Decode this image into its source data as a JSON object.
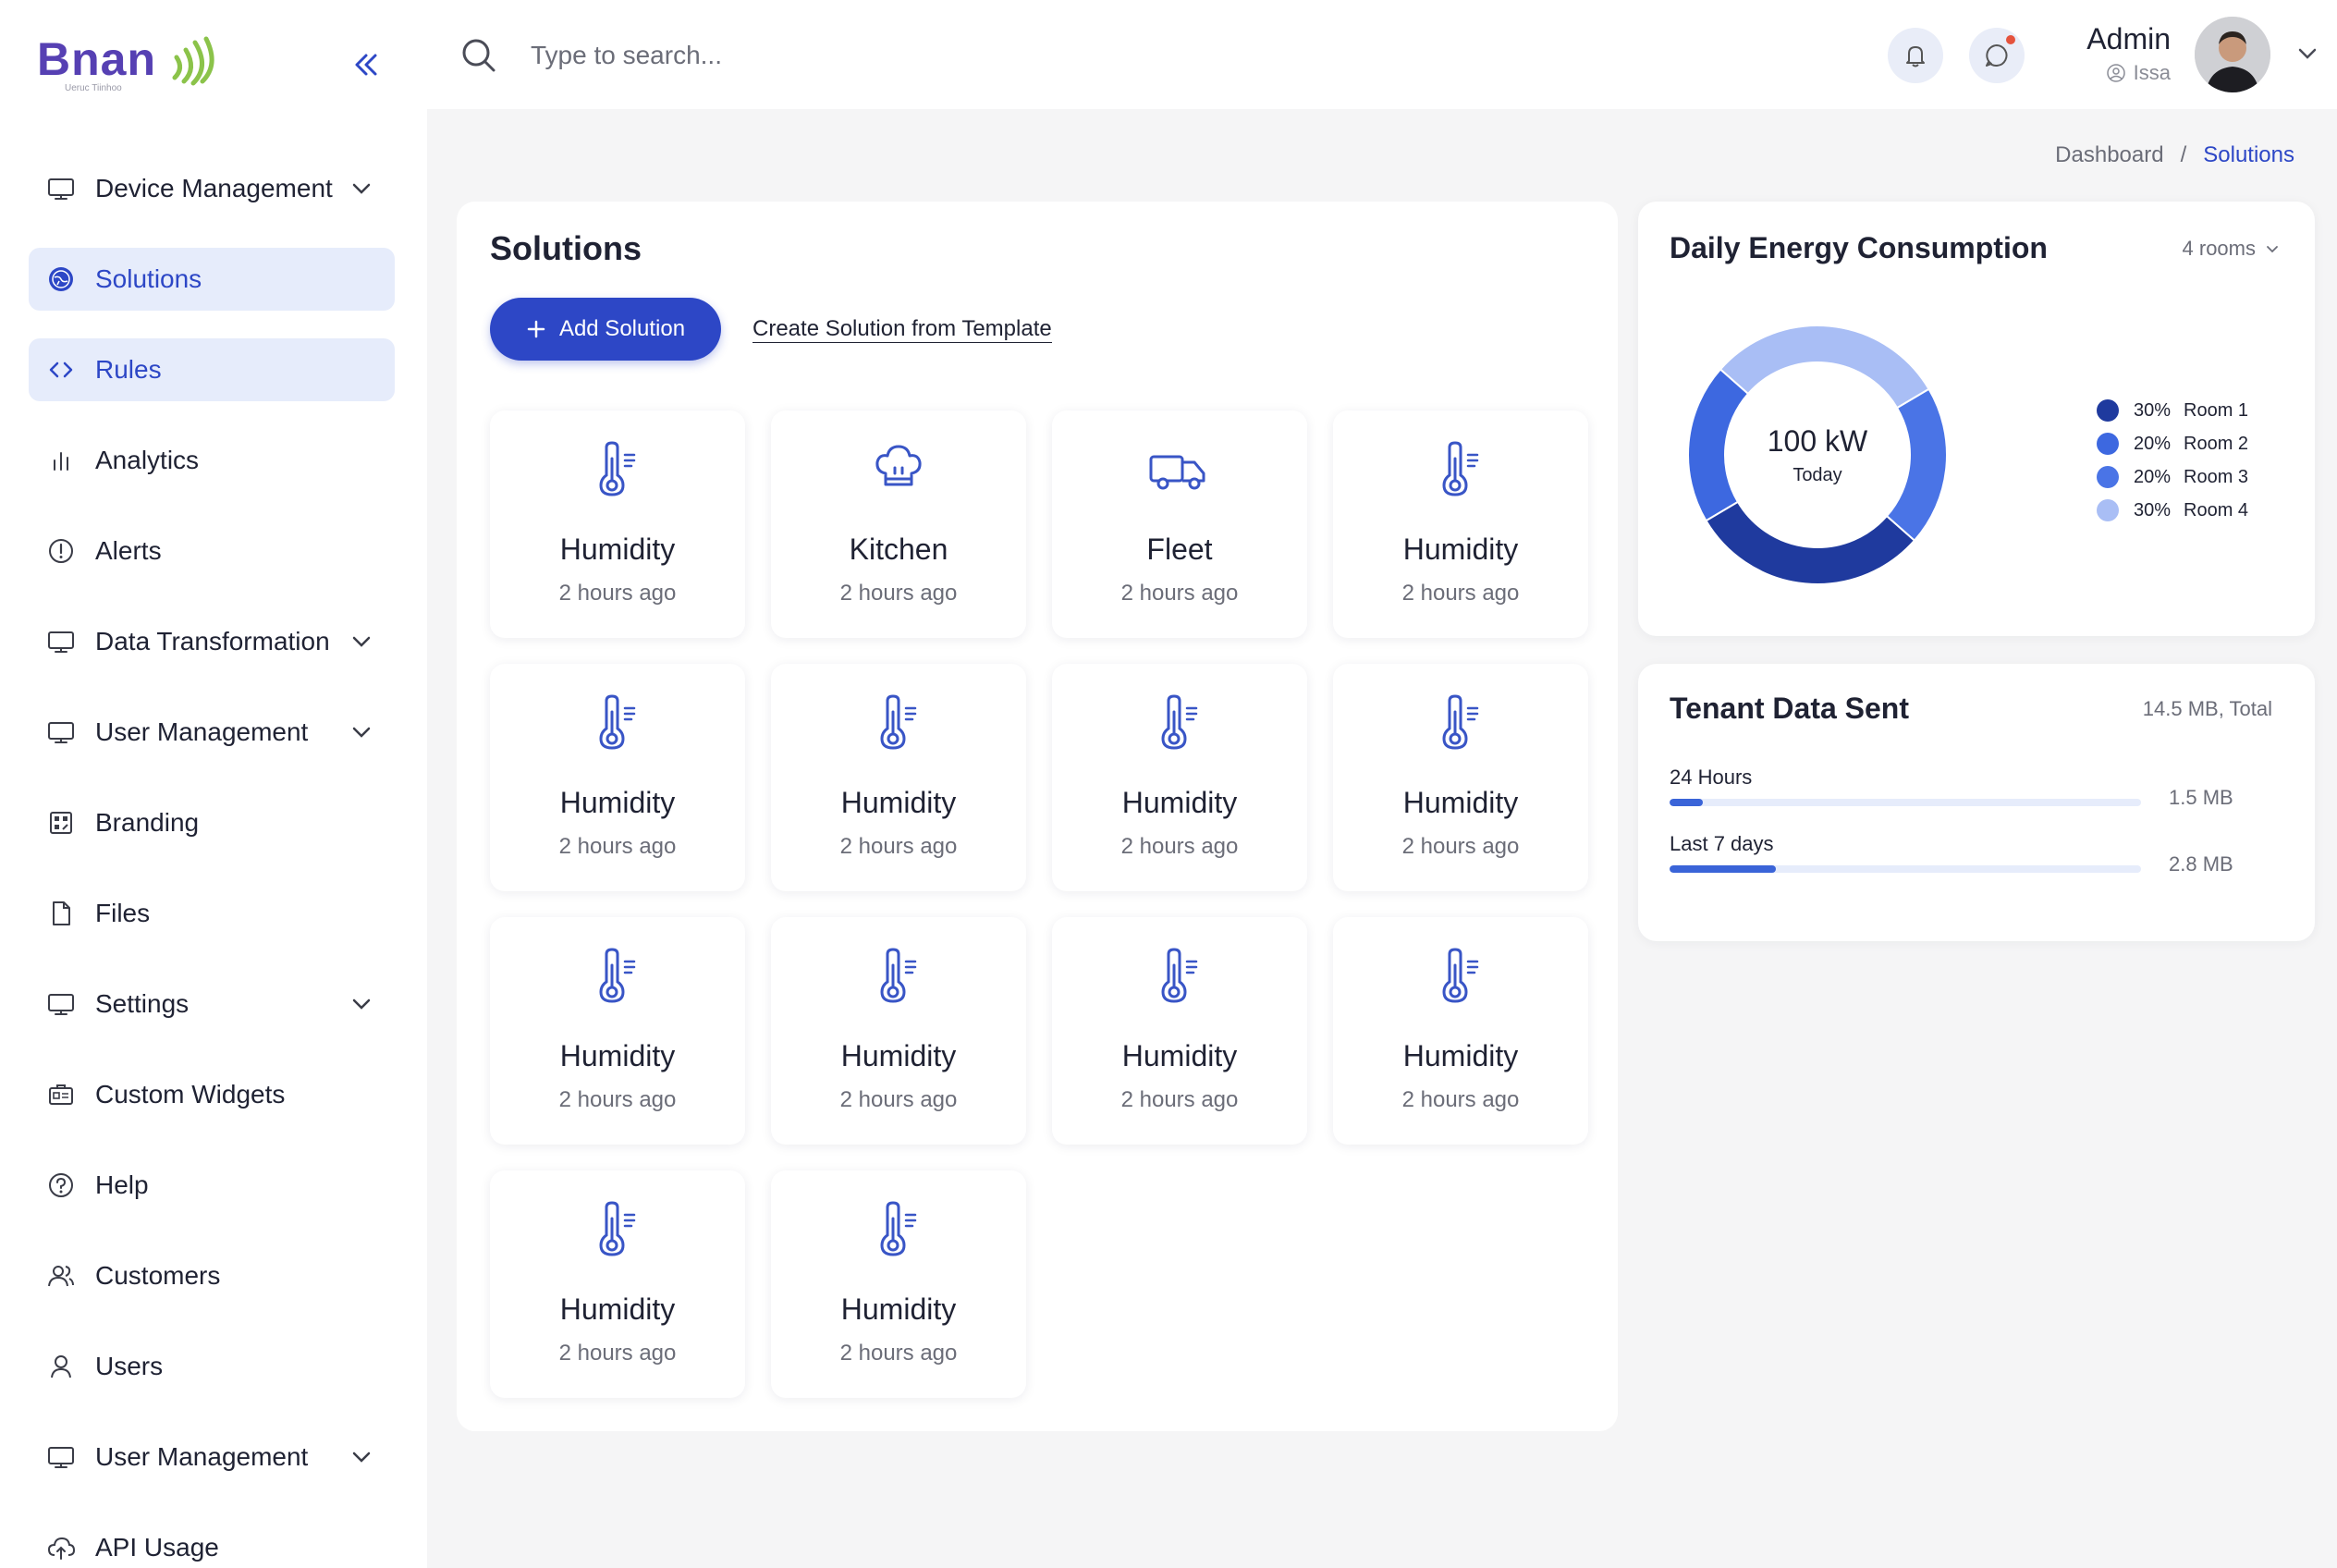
{
  "brand": {
    "name": "Bnan",
    "tagline": "Ueruc Tiinhoo"
  },
  "sidebar": {
    "items": [
      {
        "label": "Device Management",
        "icon": "monitor-icon",
        "expandable": true,
        "active": false
      },
      {
        "label": "Solutions",
        "icon": "globe-icon",
        "expandable": false,
        "active": true
      },
      {
        "label": "Rules",
        "icon": "code-icon",
        "expandable": false,
        "active": true
      },
      {
        "label": "Analytics",
        "icon": "bar-chart-icon",
        "expandable": false,
        "active": false
      },
      {
        "label": "Alerts",
        "icon": "alert-circle-icon",
        "expandable": false,
        "active": false
      },
      {
        "label": "Data Transformation",
        "icon": "monitor-icon",
        "expandable": true,
        "active": false
      },
      {
        "label": "User Management",
        "icon": "monitor-icon",
        "expandable": true,
        "active": false
      },
      {
        "label": "Branding",
        "icon": "palette-grid-icon",
        "expandable": false,
        "active": false
      },
      {
        "label": "Files",
        "icon": "file-icon",
        "expandable": false,
        "active": false
      },
      {
        "label": "Settings",
        "icon": "monitor-icon",
        "expandable": true,
        "active": false
      },
      {
        "label": "Custom Widgets",
        "icon": "widget-icon",
        "expandable": false,
        "active": false
      },
      {
        "label": "Help",
        "icon": "help-circle-icon",
        "expandable": false,
        "active": false
      },
      {
        "label": "Customers",
        "icon": "users-icon",
        "expandable": false,
        "active": false
      },
      {
        "label": "Users",
        "icon": "user-icon",
        "expandable": false,
        "active": false
      },
      {
        "label": "User Management",
        "icon": "monitor-icon",
        "expandable": true,
        "active": false
      },
      {
        "label": "API Usage",
        "icon": "cloud-upload-icon",
        "expandable": false,
        "active": false
      }
    ]
  },
  "topbar": {
    "search_placeholder": "Type to search...",
    "user": {
      "name": "Admin",
      "role": "Issa"
    }
  },
  "breadcrumb": {
    "parent": "Dashboard",
    "separator": "/",
    "current": "Solutions"
  },
  "solutions": {
    "title": "Solutions",
    "add_label": "Add Solution",
    "template_label": "Create Solution from Template",
    "cards": [
      {
        "name": "Humidity",
        "time": "2 hours ago",
        "icon": "thermometer-icon"
      },
      {
        "name": "Kitchen",
        "time": "2 hours ago",
        "icon": "chef-hat-icon"
      },
      {
        "name": "Fleet",
        "time": "2 hours ago",
        "icon": "truck-icon"
      },
      {
        "name": "Humidity",
        "time": "2 hours ago",
        "icon": "thermometer-icon"
      },
      {
        "name": "Humidity",
        "time": "2 hours ago",
        "icon": "thermometer-icon"
      },
      {
        "name": "Humidity",
        "time": "2 hours ago",
        "icon": "thermometer-icon"
      },
      {
        "name": "Humidity",
        "time": "2 hours ago",
        "icon": "thermometer-icon"
      },
      {
        "name": "Humidity",
        "time": "2 hours ago",
        "icon": "thermometer-icon"
      },
      {
        "name": "Humidity",
        "time": "2 hours ago",
        "icon": "thermometer-icon"
      },
      {
        "name": "Humidity",
        "time": "2 hours ago",
        "icon": "thermometer-icon"
      },
      {
        "name": "Humidity",
        "time": "2 hours ago",
        "icon": "thermometer-icon"
      },
      {
        "name": "Humidity",
        "time": "2 hours ago",
        "icon": "thermometer-icon"
      },
      {
        "name": "Humidity",
        "time": "2 hours ago",
        "icon": "thermometer-icon"
      },
      {
        "name": "Humidity",
        "time": "2 hours ago",
        "icon": "thermometer-icon"
      }
    ]
  },
  "energy": {
    "title": "Daily Energy Consumption",
    "rooms_select": "4 rooms",
    "center_value": "100 kW",
    "center_label": "Today"
  },
  "tenant": {
    "title": "Tenant Data Sent",
    "total": "14.5 MB, Total",
    "rows": [
      {
        "label": "24 Hours",
        "value": "1.5 MB",
        "fraction": 0.07
      },
      {
        "label": "Last 7 days",
        "value": "2.8 MB",
        "fraction": 0.225
      }
    ]
  },
  "chart_data": {
    "type": "pie",
    "categories": [
      "Room 1",
      "Room 2",
      "Room 3",
      "Room 4"
    ],
    "values": [
      30,
      20,
      20,
      30
    ],
    "percent_labels": [
      "30%",
      "20%",
      "20%",
      "30%"
    ],
    "colors": [
      "#1f3a9e",
      "#3d68e0",
      "#4a74e6",
      "#a9bef5"
    ],
    "legend": "right"
  }
}
